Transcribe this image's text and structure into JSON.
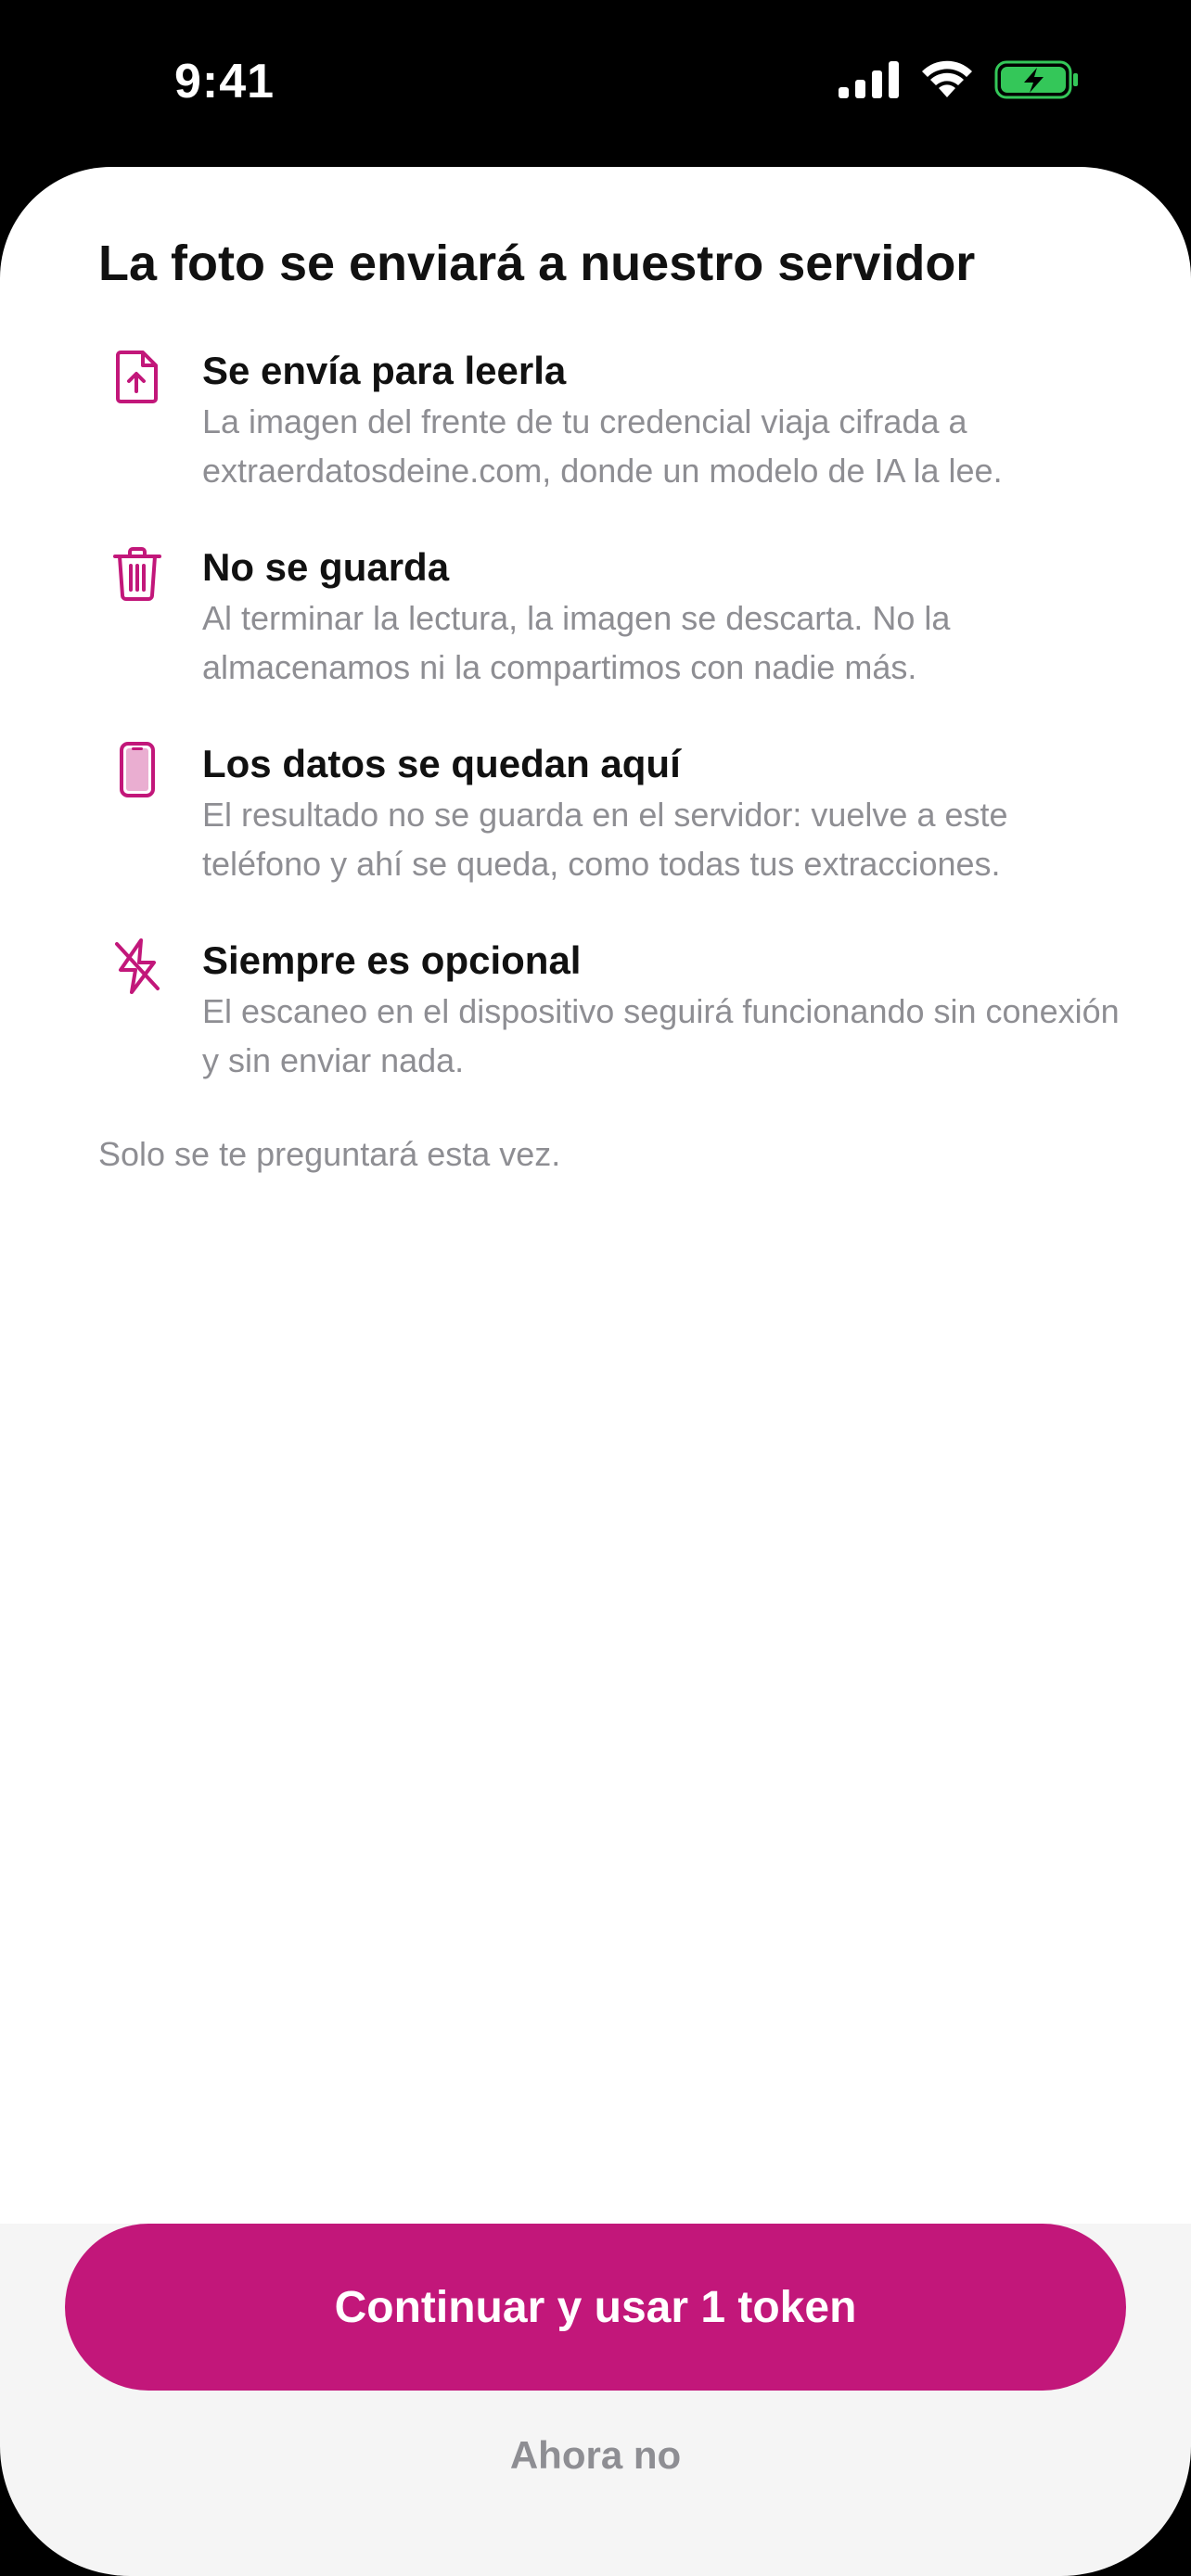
{
  "status_bar": {
    "time": "9:41",
    "icons": [
      "cellular-signal-icon",
      "wifi-icon",
      "battery-charging-icon"
    ],
    "battery_color": "#34c759"
  },
  "sheet": {
    "title": "La foto se enviará a nuestro servidor",
    "accent_color": "#c2177a",
    "items": [
      {
        "icon": "file-upload-icon",
        "title": "Se envía para leerla",
        "description": "La imagen del frente de tu credencial viaja cifrada a extraerdatosdeine.com, donde un modelo de IA la lee."
      },
      {
        "icon": "trash-icon",
        "title": "No se guarda",
        "description": "Al terminar la lectura, la imagen se descarta. No la almacenamos ni la compartimos con nadie más."
      },
      {
        "icon": "phone-icon",
        "title": "Los datos se quedan aquí",
        "description": "El resultado no se guarda en el servidor: vuelve a este teléfono y ahí se queda, como todas tus extracciones."
      },
      {
        "icon": "bolt-slash-icon",
        "title": "Siempre es opcional",
        "description": "El escaneo en el dispositivo seguirá funcionando sin conexión y sin enviar nada."
      }
    ],
    "footnote": "Solo se te preguntará esta vez."
  },
  "actions": {
    "primary_label": "Continuar y usar 1 token",
    "secondary_label": "Ahora no"
  }
}
